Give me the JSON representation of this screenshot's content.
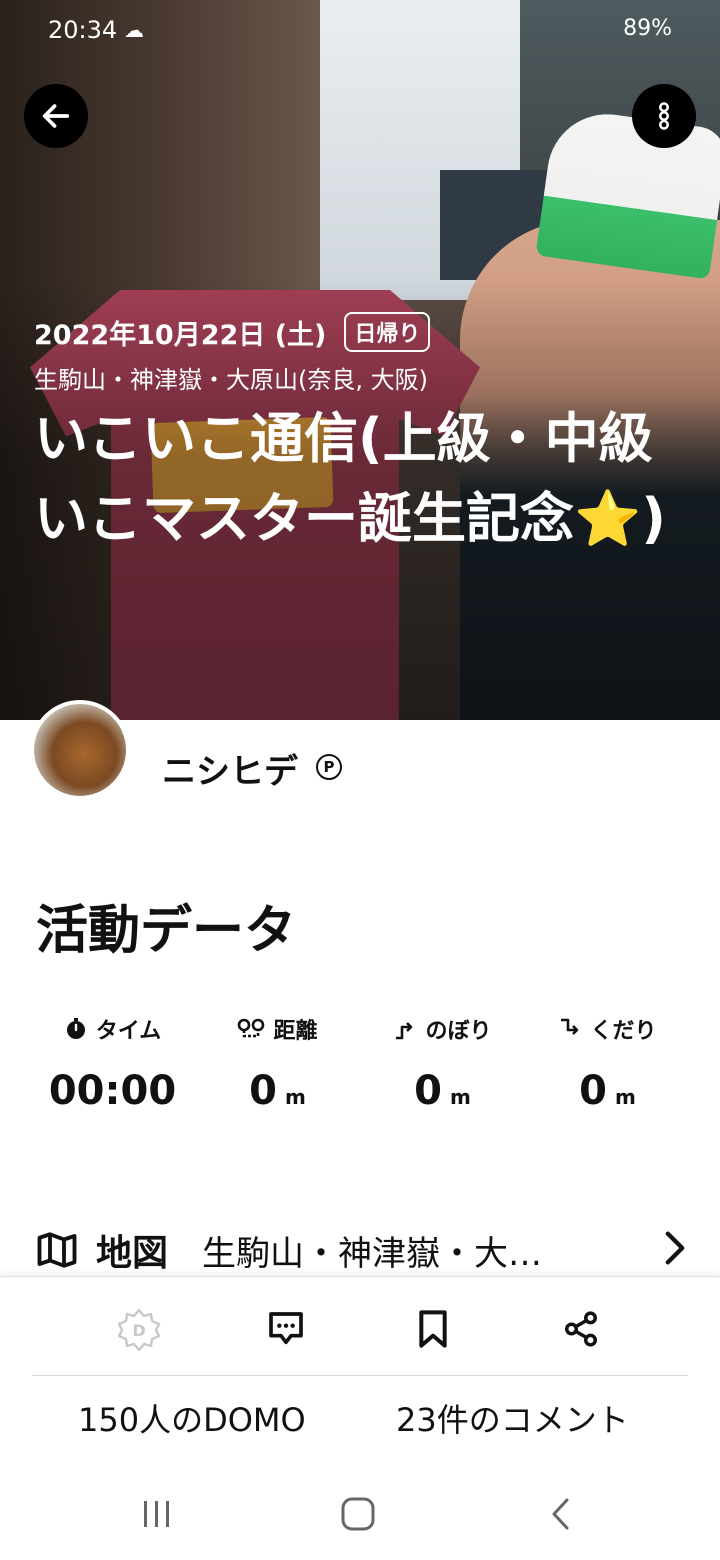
{
  "status_bar": {
    "time": "20:34",
    "weather_icon": "cloud-icon",
    "right_text": "89%"
  },
  "hero": {
    "date": "2022年10月22日 (土)",
    "badge": "日帰り",
    "mountains": "生駒山・神津嶽・大原山(奈良, 大阪)",
    "title": "いこいこ通信(上級・中級いこマスター誕生記念⭐)"
  },
  "user": {
    "name": "ニシヒデ",
    "premium_mark": "P"
  },
  "activity": {
    "section_title": "活動データ",
    "stats": [
      {
        "label": "タイム",
        "icon": "stopwatch-icon",
        "value": "00:00",
        "unit": ""
      },
      {
        "label": "距離",
        "icon": "distance-icon",
        "value": "0",
        "unit": "m"
      },
      {
        "label": "のぼり",
        "icon": "ascent-icon",
        "value": "0",
        "unit": "m"
      },
      {
        "label": "くだり",
        "icon": "descent-icon",
        "value": "0",
        "unit": "m"
      }
    ]
  },
  "map": {
    "label": "地図",
    "name": "生駒山・神津嶽・大…"
  },
  "actions": {
    "domo_count": "150人のDOMO",
    "comment_count": "23件のコメント"
  },
  "colors": {
    "accent": "#000000",
    "shirt": "#a23f55",
    "domo_disabled": "#c8c8c8"
  }
}
